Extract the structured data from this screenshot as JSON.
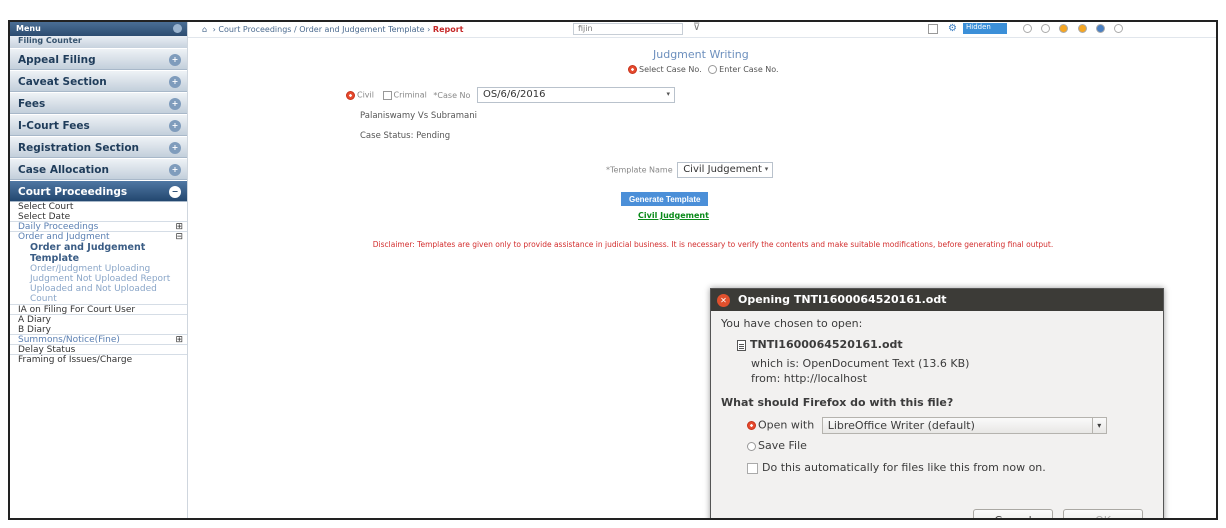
{
  "sidebar": {
    "header": "Menu",
    "cut_item": "Filing Counter",
    "groups": [
      {
        "label": "Appeal Filing"
      },
      {
        "label": "Caveat Section"
      },
      {
        "label": "Fees"
      },
      {
        "label": "I-Court Fees"
      },
      {
        "label": "Registration Section"
      },
      {
        "label": "Case Allocation"
      },
      {
        "label": "Court Proceedings"
      }
    ],
    "items": [
      "Select Court",
      "Select Date",
      "Daily Proceedings",
      "Order and Judgment",
      "Order and Judgement Template",
      "Order/Judgment Uploading",
      "Judgment Not Uploaded Report",
      "Uploaded and Not Uploaded Count",
      "IA on Filing For Court User",
      "A Diary",
      "B Diary",
      "Summons/Notice(Fine)",
      "Delay Status",
      "Framing of Issues/Charge"
    ]
  },
  "topbar": {
    "breadcrumb": [
      "Court Proceedings",
      "Order and Judgement Template",
      "Report"
    ],
    "search_value": "fijin",
    "button_label": "Hidden",
    "dot_colors": [
      "#ffffff",
      "#ffffff",
      "#f5a623",
      "#f5a623",
      "#4a7fc1",
      "#ffffff"
    ]
  },
  "main": {
    "title": "Judgment Writing",
    "radio_select_case": "Select Case No.",
    "radio_enter_case": "Enter Case No.",
    "civil_label": "Civil",
    "criminal_label": "Criminal",
    "case_no_label": "*Case No",
    "case_no_value": "OS/6/6/2016",
    "parties": "Palaniswamy Vs Subramani",
    "case_status": "Case Status: Pending",
    "template_label": "*Template Name",
    "template_value": "Civil Judgement",
    "generate_button": "Generate Template",
    "civil_link": "Civil Judgement",
    "disclaimer": "Disclaimer: Templates are given only to provide assistance in judicial business. It is necessary to verify the contents and make suitable modifications, before generating final output."
  },
  "dialog": {
    "title": "Opening TNTI1600064520161.odt",
    "chosen": "You have chosen to open:",
    "filename": "TNTI1600064520161.odt",
    "which_is": "which is: OpenDocument Text (13.6 KB)",
    "from": "from: http://localhost",
    "question": "What should Firefox do with this file?",
    "open_with": "Open with",
    "app": "LibreOffice Writer (default)",
    "save_file": "Save File",
    "auto": "Do this automatically for files like this from now on.",
    "cancel": "Cancel",
    "ok": "OK"
  }
}
